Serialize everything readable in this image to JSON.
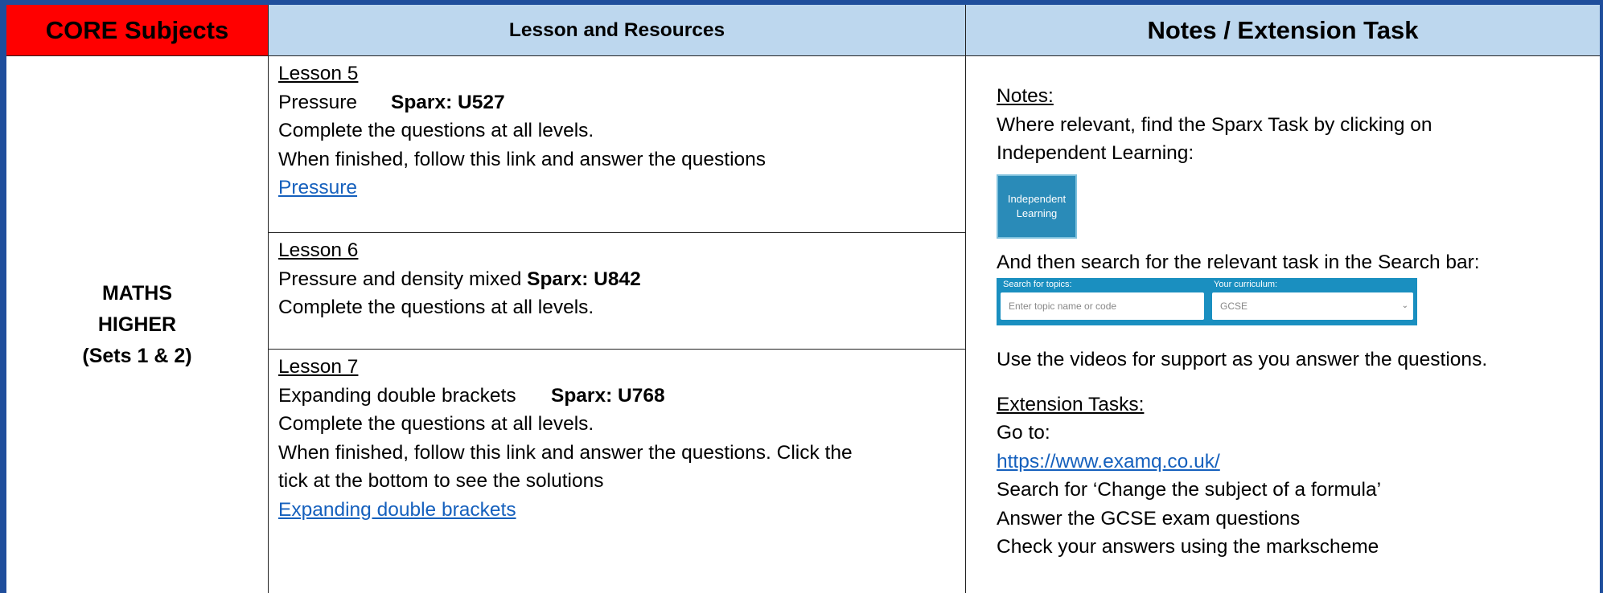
{
  "header": {
    "core": "CORE Subjects",
    "lesson": "Lesson and Resources",
    "notes": "Notes / Extension Task"
  },
  "subject": {
    "line1": "MATHS",
    "line2": "HIGHER",
    "line3": "(Sets 1 & 2)"
  },
  "colors": {
    "core_header_bg": "#ff0000",
    "header_bg": "#bdd7ee",
    "link": "#1560bd",
    "frame": "#1f4e9c"
  },
  "lessons": [
    {
      "title": "Lesson 5",
      "topic": "Pressure",
      "code": "Sparx: U527",
      "line1": "Complete the questions at all levels.",
      "line2": "When finished, follow this link and answer the questions",
      "link": "Pressure"
    },
    {
      "title": "Lesson 6",
      "topic": "Pressure and density mixed ",
      "code": "Sparx: U842",
      "line1": "Complete the questions at all levels."
    },
    {
      "title": "Lesson 7",
      "topic": "Expanding double brackets",
      "code": "Sparx: U768",
      "line1": "Complete the questions at all levels.",
      "line2": "When finished, follow this link and answer the questions. Click the",
      "line3": "tick at the bottom to see the solutions",
      "link": "Expanding double brackets"
    }
  ],
  "notes": {
    "heading": "Notes:",
    "line1": "Where relevant, find the Sparx Task by clicking on",
    "line2": "Independent Learning:",
    "button_line1": "Independent",
    "button_line2": "Learning",
    "search_line": "And then search for the relevant task in the Search bar:",
    "search_label1": "Search for topics:",
    "search_label2": "Your curriculum:",
    "search_placeholder": "Enter topic name or code",
    "curriculum_value": "GCSE",
    "videos_line": "Use the videos for support as you answer the questions.",
    "ext_heading": "Extension Tasks:",
    "goto": "Go to:",
    "url": "https://www.examq.co.uk/",
    "ext1": "Search for ‘Change the subject of a formula’",
    "ext2": "Answer the GCSE exam questions",
    "ext3": "Check your answers using the markscheme"
  }
}
